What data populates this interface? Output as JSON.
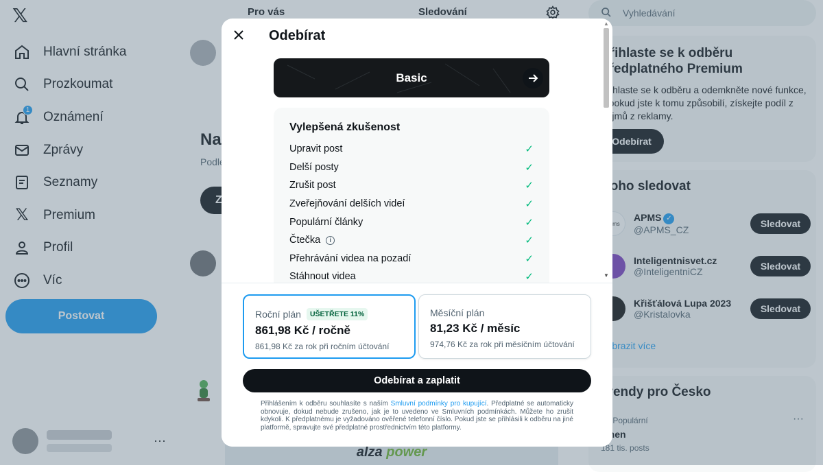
{
  "app": {
    "logo": "𝕏"
  },
  "sidebar": {
    "items": [
      {
        "label": "Hlavní stránka",
        "icon": "home-icon"
      },
      {
        "label": "Prozkoumat",
        "icon": "search-icon"
      },
      {
        "label": "Oznámení",
        "icon": "bell-icon",
        "badge": "1"
      },
      {
        "label": "Zprávy",
        "icon": "mail-icon"
      },
      {
        "label": "Seznamy",
        "icon": "list-icon"
      },
      {
        "label": "Premium",
        "icon": "x-logo-icon"
      },
      {
        "label": "Profil",
        "icon": "person-icon"
      },
      {
        "label": "Víc",
        "icon": "more-circle-icon"
      }
    ],
    "post_button": "Postovat",
    "account_more": "···"
  },
  "main": {
    "tabs": {
      "for_you": "Pro vás",
      "following": "Sledování"
    },
    "heading_partial": "Na",
    "sub_partial": "Podle",
    "pill_partial": "Z",
    "ad": {
      "brand_a": "alza",
      "brand_b": "power"
    }
  },
  "right": {
    "search_placeholder": "Vyhledávání",
    "premium": {
      "title": "Přihlaste se k odběru předplatného Premium",
      "text": "Přihlaste se k odběru a odemkněte nové funkce, a pokud jste k tomu způsobilí, získejte podíl z příjmů z reklamy.",
      "button": "Odebírat"
    },
    "who_to_follow": {
      "title": "Koho sledovat",
      "accounts": [
        {
          "name": "APMS",
          "handle": "@APMS_CZ",
          "verified": true,
          "avatar_color": "#ffffff",
          "button": "Sledovat"
        },
        {
          "name": "Inteligentnisvet.cz",
          "handle": "@InteligentniCZ",
          "verified": false,
          "avatar_color": "#7b3fbf",
          "button": "Sledovat"
        },
        {
          "name": "Křišťálová Lupa 2023",
          "handle": "@Kristalovka",
          "verified": false,
          "avatar_color": "#111111",
          "button": "Sledovat"
        }
      ],
      "show_more": "Zobrazit více"
    },
    "trends": {
      "title": "Trendy pro Česko",
      "item": {
        "context": "1 · Populární",
        "name": "Jmen",
        "count": "181 tis. posts",
        "more": "···"
      }
    }
  },
  "modal": {
    "title": "Odebírat",
    "tier": "Basic",
    "features_heading": "Vylepšená zkušenost",
    "features": [
      {
        "label": "Upravit post",
        "info": false
      },
      {
        "label": "Delší posty",
        "info": false
      },
      {
        "label": "Zrušit post",
        "info": false
      },
      {
        "label": "Zveřejňování delších videí",
        "info": false
      },
      {
        "label": "Populární články",
        "info": false
      },
      {
        "label": "Čtečka",
        "info": true
      },
      {
        "label": "Přehrávání videa na pozadí",
        "info": false
      },
      {
        "label": "Stáhnout videa",
        "info": false
      }
    ],
    "plans": {
      "yearly": {
        "name": "Roční plán",
        "badge": "UŠETŘETE 11%",
        "price": "861,98 Kč / ročně",
        "sub": "861,98 Kč za rok při ročním účtování",
        "selected": true
      },
      "monthly": {
        "name": "Měsíční plán",
        "price": "81,23 Kč / měsíc",
        "sub": "974,76 Kč za rok při měsíčním účtování",
        "selected": false
      }
    },
    "pay_button": "Odebírat a zaplatit",
    "legal": {
      "before": "Přihlášením k odběru souhlasíte s naším ",
      "link": "Smluvní podmínky pro kupující",
      "after": ". Předplatné se automaticky obnovuje, dokud nebude zrušeno, jak je to uvedeno ve Smluvních podmínkách. Můžete ho zrušit kdykoli. K předplatnému je vyžadováno ověřené telefonní číslo. Pokud jste se přihlásili k odběru na jiné platformě, spravujte své předplatné prostřednictvím této platformy."
    }
  },
  "colors": {
    "accent": "#1d9bf0",
    "check": "#00ba7c",
    "dark": "#0f1419"
  }
}
